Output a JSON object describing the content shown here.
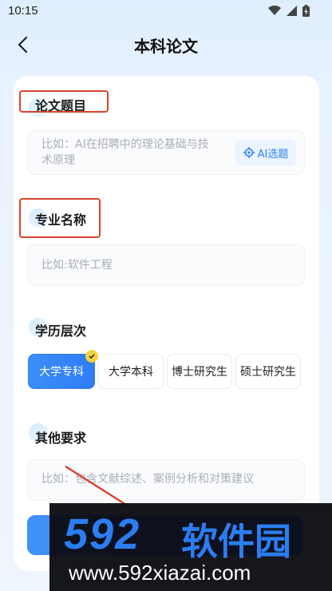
{
  "status_bar": {
    "time": "10:15"
  },
  "nav": {
    "title": "本科论文"
  },
  "form": {
    "topic": {
      "label": "论文题目",
      "placeholder": "比如：AI在招聘中的理论基础与技术原理",
      "ai_button": "AI选题"
    },
    "major": {
      "label": "专业名称",
      "placeholder": "比如:软件工程"
    },
    "education": {
      "label": "学历层次",
      "options": [
        "大学专科",
        "大学本科",
        "博士研究生",
        "硕士研究生"
      ],
      "selected": "大学专科"
    },
    "other": {
      "label": "其他要求",
      "placeholder": "比如：包含文献综述、案例分析和对策建议"
    }
  },
  "watermark": {
    "big": "592",
    "cn": "软件园",
    "url": "www.592xiazai.com"
  },
  "colors": {
    "accent": "#2f7cf4",
    "highlight": "#d7442c",
    "badge": "#f5d33f"
  }
}
